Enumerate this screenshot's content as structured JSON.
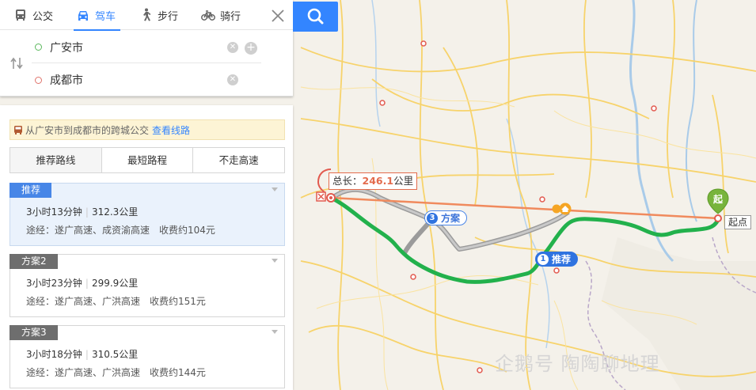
{
  "modes": [
    {
      "label": "公交",
      "icon": "bus-icon"
    },
    {
      "label": "驾车",
      "icon": "car-icon",
      "active": true
    },
    {
      "label": "步行",
      "icon": "walk-icon"
    },
    {
      "label": "骑行",
      "icon": "bike-icon"
    }
  ],
  "search": {
    "from_value": "广安市",
    "to_value": "成都市"
  },
  "bus_tip": {
    "text": "从广安市到成都市的跨城公交",
    "link": "查看线路"
  },
  "route_tabs": [
    "推荐路线",
    "最短路程",
    "不走高速"
  ],
  "plans": [
    {
      "tag": "推荐",
      "time": "3小时13分钟",
      "distance": "312.3公里",
      "via": "途经：遂广高速、成资渝高速",
      "toll": "收费约104元"
    },
    {
      "tag": "方案2",
      "time": "3小时23分钟",
      "distance": "299.9公里",
      "via": "途经：遂广高速、广洪高速",
      "toll": "收费约151元"
    },
    {
      "tag": "方案3",
      "time": "3小时18分钟",
      "distance": "310.5公里",
      "via": "途经：遂广高速、广洪高速",
      "toll": "收费约144元"
    }
  ],
  "map": {
    "total_prefix": "总长：",
    "total_value": "246.1",
    "total_unit": "公里",
    "plan3_num": "3",
    "plan3_label": "方案",
    "plan1_num": "1",
    "plan1_label": "推荐",
    "start_marker": "起",
    "start_label": "起点",
    "watermark": "企鹅号 陶陶聊地理"
  },
  "colors": {
    "accent": "#3385ff",
    "route_main": "#22b14c",
    "route_alt": "#a0a0a0",
    "measure_line": "#f08a5d"
  }
}
